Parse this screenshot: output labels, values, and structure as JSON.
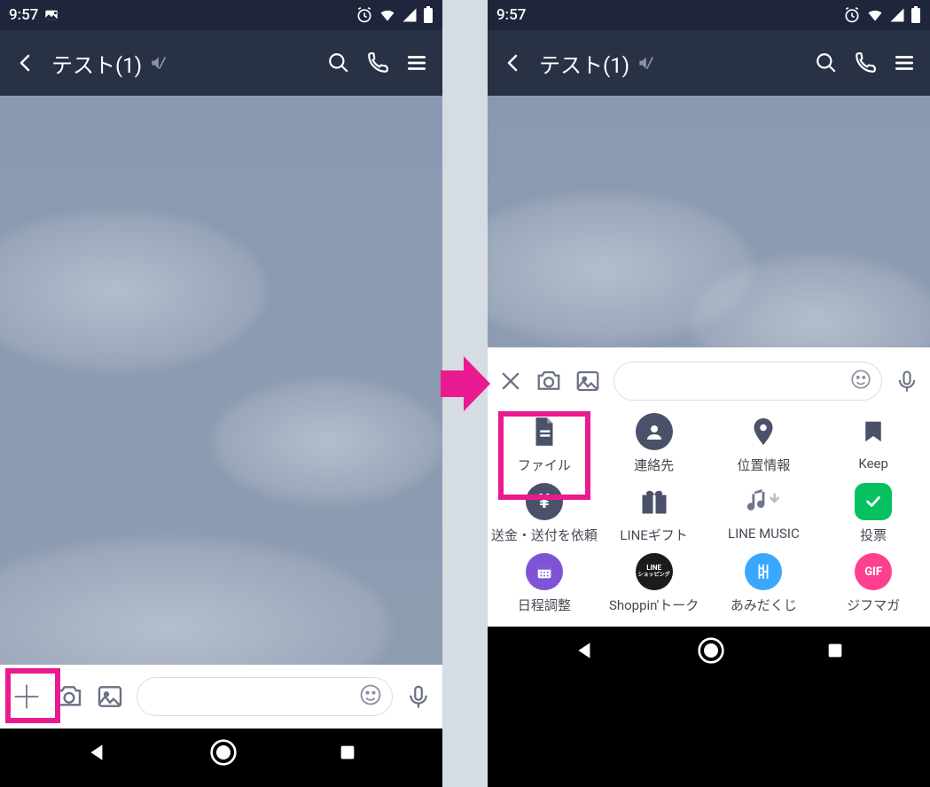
{
  "status": {
    "time": "9:57"
  },
  "header": {
    "title": "テスト(1)"
  },
  "attachments": [
    {
      "id": "file",
      "label": "ファイル"
    },
    {
      "id": "contact",
      "label": "連絡先"
    },
    {
      "id": "location",
      "label": "位置情報"
    },
    {
      "id": "keep",
      "label": "Keep"
    },
    {
      "id": "transfer",
      "label": "送金・送付を依頼"
    },
    {
      "id": "gift",
      "label": "LINEギフト"
    },
    {
      "id": "music",
      "label": "LINE MUSIC"
    },
    {
      "id": "poll",
      "label": "投票"
    },
    {
      "id": "schedule",
      "label": "日程調整"
    },
    {
      "id": "shoppin",
      "label": "Shoppin'トーク",
      "badge_top": "LINE",
      "badge_bot": "ショッピング"
    },
    {
      "id": "ladder",
      "label": "あみだくじ"
    },
    {
      "id": "gifmag",
      "label": "ジフマガ",
      "badge": "GIF"
    }
  ],
  "colors": {
    "header": "#293145",
    "highlight": "#ea1a90",
    "poll_green": "#07c05f",
    "music_gray": "#6d778c",
    "blue": "#3aa7ff",
    "gif_pink": "#ff3f8f",
    "purple": "#7d54d6"
  }
}
